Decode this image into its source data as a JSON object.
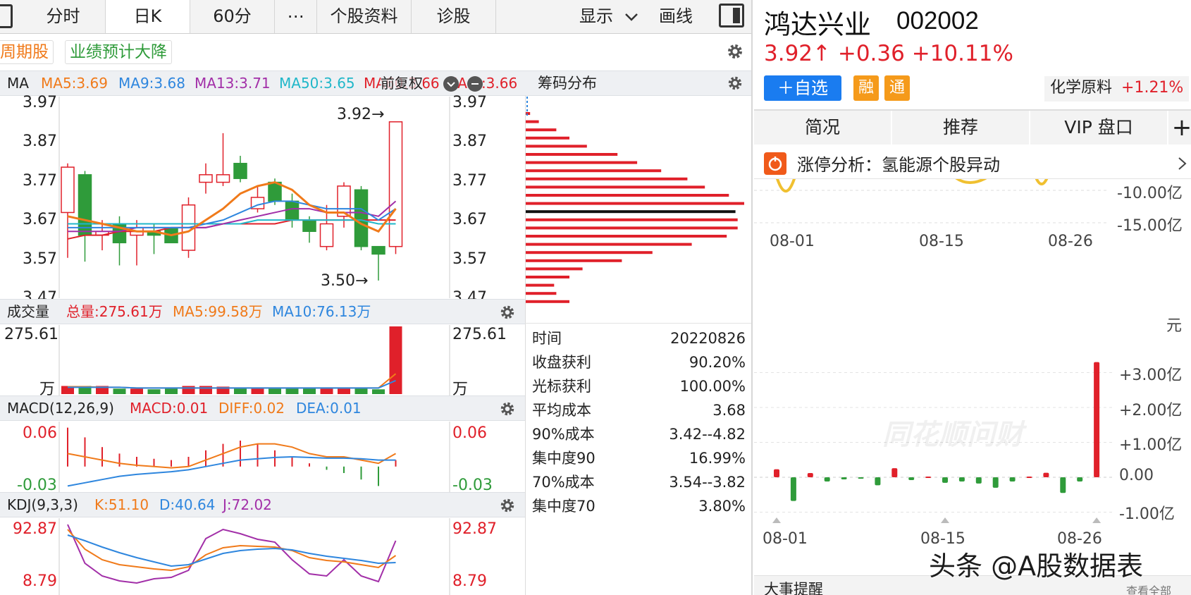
{
  "toolbar": {
    "tabs": [
      "分时",
      "日K",
      "60分",
      "⋯",
      "个股资料",
      "诊股"
    ],
    "active_tab": "日K",
    "display_label": "显示",
    "draw_label": "画线"
  },
  "tags": [
    "周期股",
    "业绩预计大降"
  ],
  "main_chart": {
    "ma_label": "MA",
    "ma_values": [
      "MA5:3.69",
      "MA9:3.68",
      "MA13:3.71",
      "MA50:3.65",
      "MA60:3.66",
      "MA…:3.66"
    ],
    "adjust_label": "前复权",
    "high_marker": "3.92→",
    "low_marker": "3.50→",
    "ticks": [
      "3.97",
      "3.87",
      "3.77",
      "3.67",
      "3.57",
      "3.47"
    ]
  },
  "volume": {
    "title": "成交量",
    "total": "总量:275.61万",
    "ma5": "MA5:99.58万",
    "ma10": "MA10:76.13万",
    "top_tick": "275.61",
    "unit": "万"
  },
  "macd": {
    "title": "MACD(12,26,9)",
    "macd": "MACD:0.01",
    "diff": "DIFF:0.02",
    "dea": "DEA:0.01",
    "ticks": [
      "0.06",
      "-0.03"
    ]
  },
  "kdj": {
    "title": "KDJ(9,3,3)",
    "k": "K:51.10",
    "d": "D:40.64",
    "j": "J:72.02",
    "ticks": [
      "92.87",
      "8.79"
    ]
  },
  "chip": {
    "title": "筹码分布",
    "stats": [
      {
        "k": "时间",
        "v": "20220826"
      },
      {
        "k": "收盘获利",
        "v": "90.20%"
      },
      {
        "k": "光标获利",
        "v": "100.00%"
      },
      {
        "k": "平均成本",
        "v": "3.68"
      },
      {
        "k": "90%成本",
        "v": "3.42--4.82"
      },
      {
        "k": "集中度90",
        "v": "16.99%"
      },
      {
        "k": "70%成本",
        "v": "3.54--3.82"
      },
      {
        "k": "集中度70",
        "v": "3.80%"
      }
    ]
  },
  "stock": {
    "name": "鸿达兴业",
    "code": "002002",
    "price": "3.92↑",
    "change": "+0.36",
    "pct": "+10.11%",
    "add_watch": "＋自选",
    "badge_rong": "融",
    "badge_tong": "通",
    "sector": "化学原料",
    "sector_pct": "+1.21%"
  },
  "right_tabs": [
    "简况",
    "推荐",
    "VIP 盘口"
  ],
  "plus": "+",
  "alert": {
    "text": "涨停分析：氢能源个股异动"
  },
  "flow_top": {
    "ticks": [
      "-10.00亿",
      "-15.00亿"
    ],
    "dates": [
      "08-01",
      "08-15",
      "08-26"
    ]
  },
  "flow_bottom": {
    "unit": "元",
    "ticks": [
      "+3.00亿",
      "+2.00亿",
      "+1.00亿",
      "0.00",
      "-1.00亿"
    ],
    "dates": [
      "08-01",
      "08-15",
      "08-26"
    ],
    "watermark": "同花顺问财"
  },
  "events_title": "大事提醒",
  "see_all": "查看全部",
  "credit": "头条 @A股数据表",
  "colors": {
    "up": "#e0202a",
    "down": "#2f9b3a",
    "ma5": "#f07a1a",
    "ma9": "#2e86de",
    "ma13": "#a22fa8",
    "ma50": "#20b7c9",
    "ma60": "#e0202a",
    "brand_blue": "#1a7cf0",
    "badge_orange": "#f59a1a"
  },
  "chart_data": {
    "type": "candlestick",
    "ylim": [
      3.47,
      3.97
    ],
    "candles": [
      {
        "o": 3.68,
        "c": 3.8,
        "h": 3.81,
        "l": 3.56
      },
      {
        "o": 3.78,
        "c": 3.62,
        "h": 3.79,
        "l": 3.55
      },
      {
        "o": 3.62,
        "c": 3.63,
        "h": 3.66,
        "l": 3.58
      },
      {
        "o": 3.65,
        "c": 3.6,
        "h": 3.67,
        "l": 3.54
      },
      {
        "o": 3.62,
        "c": 3.64,
        "h": 3.66,
        "l": 3.54
      },
      {
        "o": 3.63,
        "c": 3.62,
        "h": 3.65,
        "l": 3.57
      },
      {
        "o": 3.64,
        "c": 3.6,
        "h": 3.64,
        "l": 3.6
      },
      {
        "o": 3.58,
        "c": 3.7,
        "h": 3.72,
        "l": 3.56
      },
      {
        "o": 3.76,
        "c": 3.78,
        "h": 3.81,
        "l": 3.73
      },
      {
        "o": 3.76,
        "c": 3.78,
        "h": 3.89,
        "l": 3.75
      },
      {
        "o": 3.81,
        "c": 3.77,
        "h": 3.83,
        "l": 3.76
      },
      {
        "o": 3.69,
        "c": 3.72,
        "h": 3.75,
        "l": 3.68
      },
      {
        "o": 3.76,
        "c": 3.71,
        "h": 3.77,
        "l": 3.7
      },
      {
        "o": 3.71,
        "c": 3.66,
        "h": 3.73,
        "l": 3.64
      },
      {
        "o": 3.66,
        "c": 3.63,
        "h": 3.67,
        "l": 3.6
      },
      {
        "o": 3.59,
        "c": 3.65,
        "h": 3.7,
        "l": 3.58
      },
      {
        "o": 3.67,
        "c": 3.75,
        "h": 3.76,
        "l": 3.64
      },
      {
        "o": 3.74,
        "c": 3.59,
        "h": 3.75,
        "l": 3.58
      },
      {
        "o": 3.59,
        "c": 3.57,
        "h": 3.59,
        "l": 3.5
      },
      {
        "o": 3.59,
        "c": 3.92,
        "h": 3.92,
        "l": 3.57
      }
    ],
    "ma5": [
      3.67,
      3.66,
      3.65,
      3.64,
      3.63,
      3.63,
      3.62,
      3.63,
      3.66,
      3.69,
      3.73,
      3.75,
      3.76,
      3.74,
      3.7,
      3.68,
      3.68,
      3.65,
      3.63,
      3.69
    ],
    "ma9": [
      3.64,
      3.64,
      3.64,
      3.64,
      3.64,
      3.64,
      3.64,
      3.64,
      3.65,
      3.66,
      3.68,
      3.7,
      3.71,
      3.71,
      3.7,
      3.69,
      3.69,
      3.69,
      3.66,
      3.69
    ],
    "ma13": [
      3.63,
      3.63,
      3.63,
      3.63,
      3.64,
      3.64,
      3.64,
      3.64,
      3.64,
      3.65,
      3.66,
      3.67,
      3.68,
      3.69,
      3.69,
      3.68,
      3.68,
      3.68,
      3.67,
      3.71
    ],
    "ma50": [
      3.65,
      3.65,
      3.65,
      3.65,
      3.65,
      3.65,
      3.65,
      3.65,
      3.65,
      3.65,
      3.65,
      3.66,
      3.66,
      3.66,
      3.66,
      3.66,
      3.66,
      3.66,
      3.65,
      3.65
    ],
    "ma60": [
      3.61,
      3.62,
      3.62,
      3.63,
      3.63,
      3.63,
      3.64,
      3.64,
      3.64,
      3.65,
      3.65,
      3.65,
      3.65,
      3.66,
      3.66,
      3.66,
      3.66,
      3.66,
      3.66,
      3.66
    ],
    "volume": [
      0.12,
      0.12,
      0.12,
      0.08,
      0.08,
      0.07,
      0.08,
      0.12,
      0.12,
      0.11,
      0.09,
      0.08,
      0.08,
      0.08,
      0.09,
      0.08,
      0.08,
      0.09,
      0.07,
      1.0
    ],
    "volume_ma5": [
      0.11,
      0.11,
      0.1,
      0.1,
      0.09,
      0.09,
      0.09,
      0.09,
      0.09,
      0.09,
      0.09,
      0.09,
      0.09,
      0.09,
      0.09,
      0.09,
      0.09,
      0.09,
      0.09,
      0.3
    ],
    "volume_ma10": [
      0.1,
      0.1,
      0.1,
      0.1,
      0.09,
      0.09,
      0.09,
      0.09,
      0.09,
      0.09,
      0.09,
      0.09,
      0.09,
      0.09,
      0.09,
      0.09,
      0.09,
      0.09,
      0.09,
      0.2
    ],
    "macd_hist": [
      0.06,
      0.045,
      0.03,
      0.02,
      0.015,
      0.012,
      0.01,
      0.015,
      0.025,
      0.035,
      0.04,
      0.035,
      0.025,
      0.015,
      0.005,
      -0.005,
      -0.01,
      -0.02,
      -0.03,
      0.01
    ],
    "diff": [
      0.02,
      0.015,
      0.01,
      0.005,
      0.002,
      0.0,
      -0.002,
      0.0,
      0.01,
      0.02,
      0.03,
      0.035,
      0.035,
      0.03,
      0.02,
      0.015,
      0.015,
      0.01,
      0.005,
      0.02
    ],
    "dea": [
      -0.03,
      -0.025,
      -0.02,
      -0.015,
      -0.012,
      -0.01,
      -0.008,
      -0.005,
      0.0,
      0.005,
      0.01,
      0.012,
      0.014,
      0.015,
      0.014,
      0.013,
      0.013,
      0.012,
      0.01,
      0.01
    ],
    "kdj_k": [
      88,
      60,
      45,
      38,
      35,
      32,
      30,
      35,
      52,
      62,
      65,
      64,
      63,
      58,
      48,
      44,
      42,
      38,
      34,
      51
    ],
    "kdj_d": [
      80,
      72,
      63,
      55,
      48,
      42,
      36,
      38,
      46,
      54,
      58,
      60,
      61,
      59,
      54,
      50,
      47,
      44,
      40,
      41
    ],
    "kdj_j": [
      95,
      40,
      22,
      15,
      12,
      18,
      20,
      30,
      75,
      88,
      82,
      74,
      70,
      45,
      25,
      22,
      45,
      22,
      14,
      72
    ],
    "chip_levels": [
      0.02,
      0.06,
      0.14,
      0.2,
      0.28,
      0.42,
      0.51,
      0.62,
      0.74,
      0.82,
      0.93,
      1.0,
      0.96,
      0.97,
      0.97,
      0.92,
      0.76,
      0.58,
      0.44,
      0.26,
      0.2,
      0.13,
      0.14,
      0.2
    ],
    "flow_top_line": [
      -8.5,
      -12.4,
      -9.2,
      -8.1,
      -7.3
    ],
    "flow_bars": [
      0.23,
      -0.68,
      0.12,
      -0.12,
      -0.06,
      -0.02,
      -0.23,
      0.26,
      -0.08,
      0.02,
      -0.16,
      -0.12,
      -0.18,
      -0.3,
      -0.12,
      0.02,
      0.13,
      -0.45,
      -0.12,
      3.3
    ]
  }
}
